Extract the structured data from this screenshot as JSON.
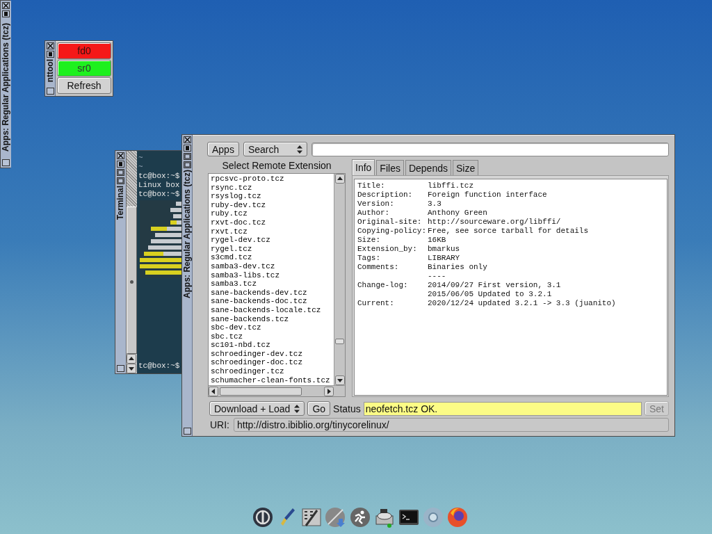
{
  "side_window": {
    "title": "Apps: Regular Applications (tcz)"
  },
  "mnttool": {
    "title": "nttool",
    "devices": [
      {
        "label": "fd0",
        "mounted": false
      },
      {
        "label": "sr0",
        "mounted": true
      }
    ],
    "refresh_button": "Refresh"
  },
  "terminal": {
    "title": "Terminal",
    "lines": [
      "~",
      "~",
      "tc@box:~$",
      "Linux box",
      "tc@box:~$"
    ],
    "prompt": "tc@box:~$"
  },
  "apps_window": {
    "title": "Apps: Regular Applications (tcz)",
    "apps_button": "Apps",
    "search_select": "Search",
    "list_heading": "Select Remote Extension",
    "extensions": [
      "rpcsvc-proto.tcz",
      "rsync.tcz",
      "rsyslog.tcz",
      "ruby-dev.tcz",
      "ruby.tcz",
      "rxvt-doc.tcz",
      "rxvt.tcz",
      "rygel-dev.tcz",
      "rygel.tcz",
      "s3cmd.tcz",
      "samba3-dev.tcz",
      "samba3-libs.tcz",
      "samba3.tcz",
      "sane-backends-dev.tcz",
      "sane-backends-doc.tcz",
      "sane-backends-locale.tcz",
      "sane-backends.tcz",
      "sbc-dev.tcz",
      "sbc.tcz",
      "sc101-nbd.tcz",
      "schroedinger-dev.tcz",
      "schroedinger-doc.tcz",
      "schroedinger.tcz",
      "schumacher-clean-fonts.tcz"
    ],
    "tabs": [
      {
        "label": "Info",
        "selected": true
      },
      {
        "label": "Files",
        "selected": false
      },
      {
        "label": "Depends",
        "selected": false
      },
      {
        "label": "Size",
        "selected": false
      }
    ],
    "info": [
      {
        "key": "Title:",
        "value": "libffi.tcz"
      },
      {
        "key": "Description:",
        "value": "Foreign function interface"
      },
      {
        "key": "Version:",
        "value": "3.3"
      },
      {
        "key": "Author:",
        "value": "Anthony Green"
      },
      {
        "key": "Original-site:",
        "value": "http://sourceware.org/libffi/"
      },
      {
        "key": "Copying-policy:",
        "value": "Free, see sorce tarball for details"
      },
      {
        "key": "Size:",
        "value": "16KB"
      },
      {
        "key": "Extension_by:",
        "value": "bmarkus"
      },
      {
        "key": "Tags:",
        "value": "LIBRARY"
      },
      {
        "key": "Comments:",
        "value": "Binaries only"
      },
      {
        "value": "----"
      },
      {
        "key": "Change-log:",
        "value": "2014/09/27 First version, 3.1"
      },
      {
        "value": "2015/06/05 Updated to 3.2.1"
      },
      {
        "key": "Current:",
        "value": "2020/12/24 updated 3.2.1 -> 3.3 (juanito)"
      }
    ],
    "action_select": "Download + Load",
    "go_button": "Go",
    "status_label": "Status",
    "status_value": "neofetch.tcz OK.",
    "set_button": {
      "label": "Set",
      "disabled": true
    },
    "uri_label": "URI:",
    "uri_value": "http://distro.ibiblio.org/tinycorelinux/"
  }
}
